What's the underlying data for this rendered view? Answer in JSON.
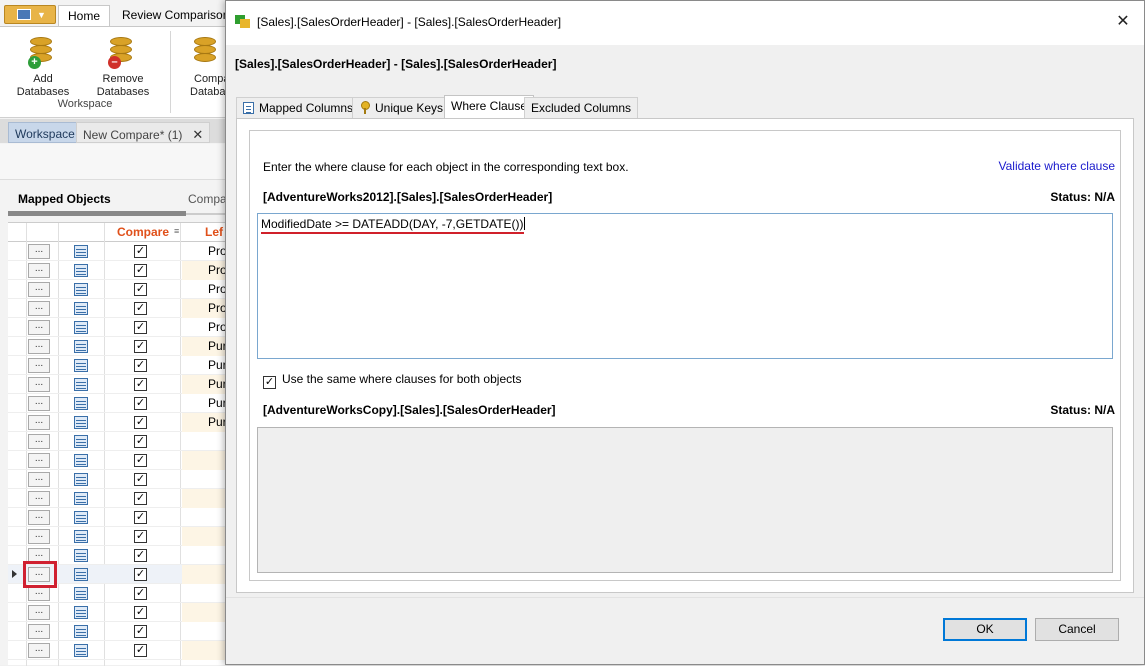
{
  "app": {
    "ribbon_tabs": [
      "Home",
      "Review Comparison"
    ],
    "ribbon_buttons": {
      "add": [
        "Add",
        "Databases"
      ],
      "remove": [
        "Remove",
        "Databases"
      ],
      "compare": [
        "Compa",
        "Databa"
      ]
    },
    "group_label": "Workspace",
    "doc_tabs": {
      "workspace": "Workspace",
      "compare": "New Compare* (1)",
      "close": "✕"
    },
    "section_title": "Mapped Objects",
    "section_title_2": "Compa",
    "grid": {
      "header_compare": "Compare",
      "header_left": "Lef",
      "rows": [
        "Pro",
        "Pro",
        "Pro",
        "Pro",
        "Pro",
        "Pur",
        "Pur",
        "Pur",
        "Pur",
        "Pur",
        "",
        "",
        "",
        "",
        "",
        "",
        "",
        "",
        "",
        "",
        "",
        ""
      ],
      "dots_label": "...",
      "check_mark": "✓"
    }
  },
  "dialog": {
    "title": "[Sales].[SalesOrderHeader] - [Sales].[SalesOrderHeader]",
    "close": "✕",
    "header_label": "[Sales].[SalesOrderHeader] - [Sales].[SalesOrderHeader]",
    "tabs": {
      "mapped_columns": "Mapped Columns",
      "unique_keys": "Unique Keys",
      "where_clause": "Where Clause",
      "excluded_columns": "Excluded Columns"
    },
    "instruction": "Enter the where clause for each object in the corresponding text box.",
    "validate_link": "Validate where clause",
    "left_object": "[AdventureWorks2012].[Sales].[SalesOrderHeader]",
    "left_status": "Status: N/A",
    "left_where_value": "ModifiedDate >= DATEADD(DAY, -7,GETDATE())",
    "same_clause_label": "Use the same where clauses for both objects",
    "same_clause_checked": "✓",
    "right_object": "[AdventureWorksCopy].[Sales].[SalesOrderHeader]",
    "right_status": "Status: N/A",
    "ok_label": "OK",
    "cancel_label": "Cancel"
  }
}
